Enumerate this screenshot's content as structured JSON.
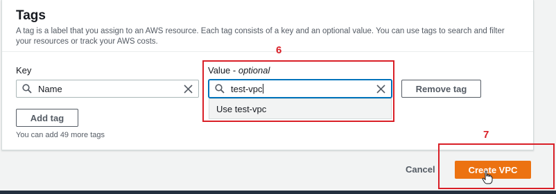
{
  "tags": {
    "title": "Tags",
    "description": "A tag is a label that you assign to an AWS resource. Each tag consists of a key and an optional value. You can use tags to search and filter your resources or track your AWS costs.",
    "key_label": "Key",
    "value_label": "Value - ",
    "value_label_optional": "optional",
    "key_value": "Name",
    "value_value": "test-vpc",
    "suggestion": "Use test-vpc",
    "remove_tag": "Remove tag",
    "add_tag": "Add tag",
    "remaining_hint": "You can add 49 more tags"
  },
  "annotations": {
    "step_value": "6",
    "step_create": "7"
  },
  "footer": {
    "cancel": "Cancel",
    "create": "Create VPC"
  },
  "icons": {
    "search": "search-icon",
    "clear": "close-icon",
    "cursor": "hand-pointer-icon"
  },
  "colors": {
    "primary": "#ec7211",
    "annotation": "#d91e26",
    "focus": "#0073bb"
  }
}
